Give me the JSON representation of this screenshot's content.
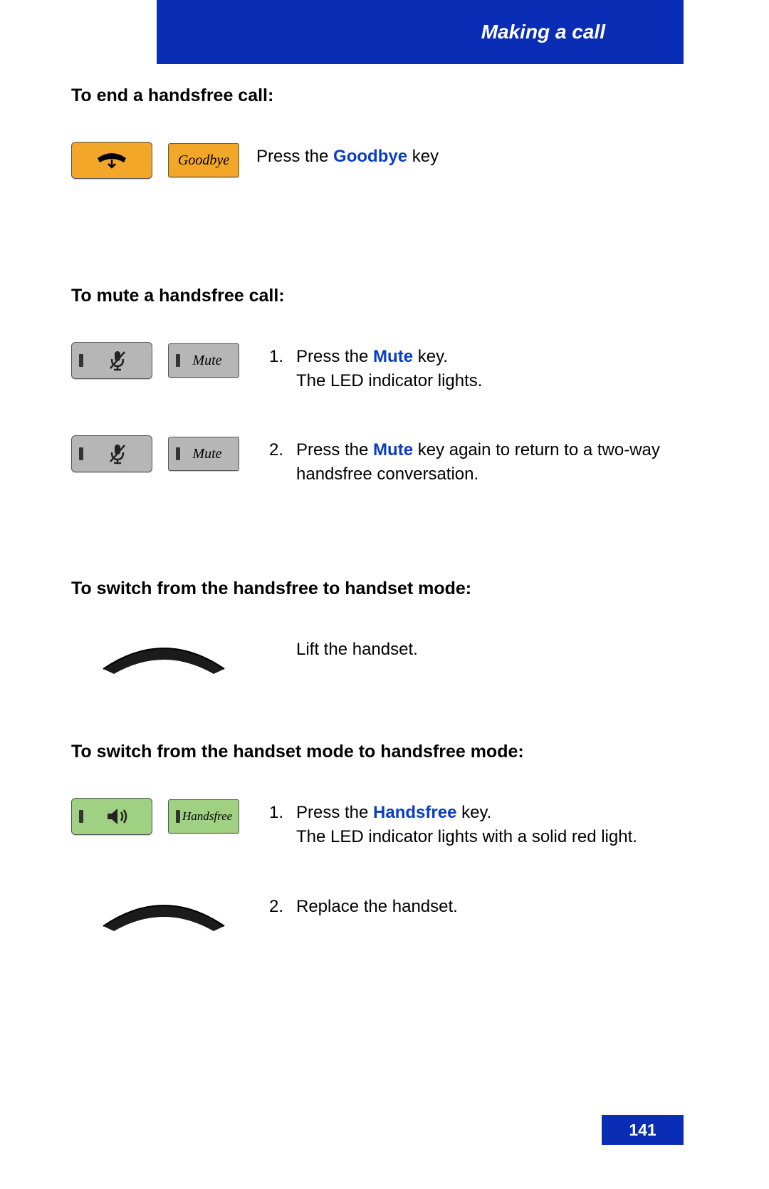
{
  "header": {
    "title": "Making a call"
  },
  "footer": {
    "page_number": "141"
  },
  "sections": [
    {
      "heading": "To end a handsfree call:",
      "rows": [
        {
          "icons": {
            "type": "phone-down-orange",
            "label_button": "Goodbye"
          },
          "numbered": false,
          "text_before": "Press the ",
          "key_term": "Goodbye",
          "text_after": " key"
        }
      ]
    },
    {
      "heading": "To mute a handsfree call:",
      "rows": [
        {
          "icons": {
            "type": "mic-mute-gray",
            "label_button": "Mute"
          },
          "numbered": true,
          "num": "1.",
          "text_before": "Press the ",
          "key_term": "Mute",
          "text_after": " key.",
          "extra_line": "The LED indicator lights."
        },
        {
          "icons": {
            "type": "mic-mute-gray",
            "label_button": "Mute"
          },
          "numbered": true,
          "num": "2.",
          "text_before": "Press the ",
          "key_term": "Mute",
          "text_after": " key again to return to a two-way handsfree conversation."
        }
      ]
    },
    {
      "heading": "To switch from the handsfree to handset mode:",
      "rows": [
        {
          "icons": {
            "type": "handset"
          },
          "numbered": false,
          "plain_text": "Lift the handset."
        }
      ]
    },
    {
      "heading": "To switch from the handset mode to handsfree mode:",
      "rows": [
        {
          "icons": {
            "type": "speaker-green",
            "label_button": "Handsfree"
          },
          "numbered": true,
          "num": "1.",
          "text_before": "Press the ",
          "key_term": "Handsfree",
          "text_after": " key.",
          "extra_line": "The LED indicator lights with a solid red light."
        },
        {
          "icons": {
            "type": "handset"
          },
          "numbered": true,
          "num": "2.",
          "plain_text": "Replace the handset."
        }
      ]
    }
  ]
}
